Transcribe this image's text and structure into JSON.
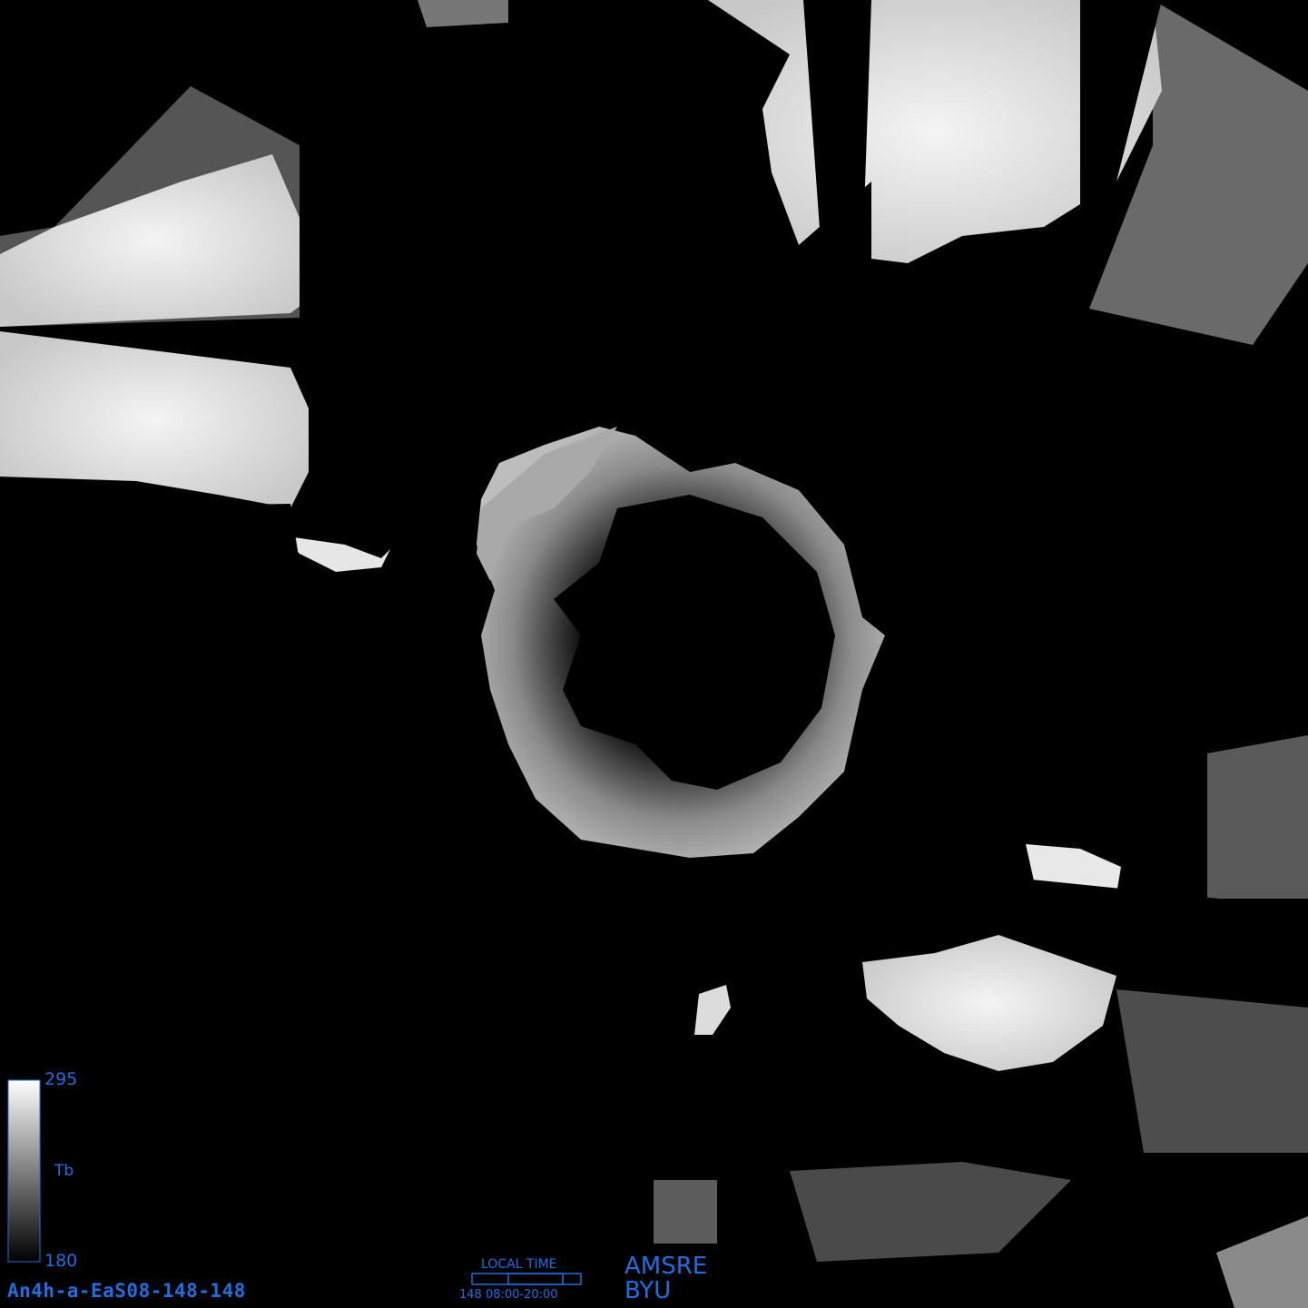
{
  "colorbar": {
    "max_label": "295",
    "min_label": "180",
    "variable_label": "Tb",
    "gradient_top": "#ffffff",
    "gradient_bottom": "#000000",
    "frame_color": "#1f6fe0"
  },
  "image_id": "An4h-a-EaS08-148-148",
  "local_time": {
    "title": "LOCAL TIME",
    "range_text": "148 08:00-20:00"
  },
  "source": {
    "sensor": "AMSRE",
    "institution": "BYU"
  },
  "colors": {
    "background": "#000000",
    "label_text": "#1f6fe0"
  }
}
